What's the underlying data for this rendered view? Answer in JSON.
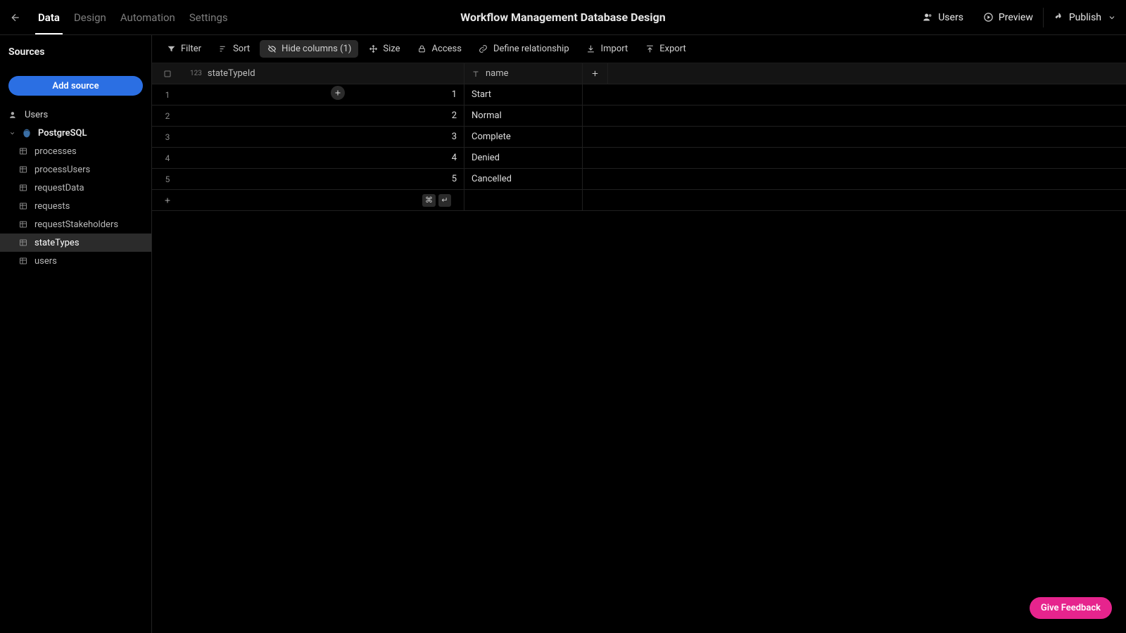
{
  "header": {
    "title": "Workflow Management Database Design",
    "tabs": [
      "Data",
      "Design",
      "Automation",
      "Settings"
    ],
    "active_tab_index": 0,
    "right": {
      "users": "Users",
      "preview": "Preview",
      "publish": "Publish"
    }
  },
  "sidebar": {
    "heading": "Sources",
    "add_label": "Add source",
    "users_entry": "Users",
    "datasource": {
      "name": "PostgreSQL",
      "expanded": true
    },
    "tables": [
      "processes",
      "processUsers",
      "requestData",
      "requests",
      "requestStakeholders",
      "stateTypes",
      "users"
    ],
    "active_table": "stateTypes"
  },
  "toolbar": {
    "filter": "Filter",
    "sort": "Sort",
    "hide": "Hide columns (1)",
    "size": "Size",
    "access": "Access",
    "define": "Define relationship",
    "import": "Import",
    "export": "Export"
  },
  "columns": [
    {
      "key": "stateTypeId",
      "label": "stateTypeId",
      "type": "123"
    },
    {
      "key": "name",
      "label": "name",
      "type": "T"
    }
  ],
  "rows": [
    {
      "n": 1,
      "stateTypeId": 1,
      "name": "Start"
    },
    {
      "n": 2,
      "stateTypeId": 2,
      "name": "Normal"
    },
    {
      "n": 3,
      "stateTypeId": 3,
      "name": "Complete"
    },
    {
      "n": 4,
      "stateTypeId": 4,
      "name": "Denied"
    },
    {
      "n": 5,
      "stateTypeId": 5,
      "name": "Cancelled"
    }
  ],
  "shortcuts": {
    "cmd": "⌘",
    "enter": "↵"
  },
  "feedback": "Give Feedback"
}
